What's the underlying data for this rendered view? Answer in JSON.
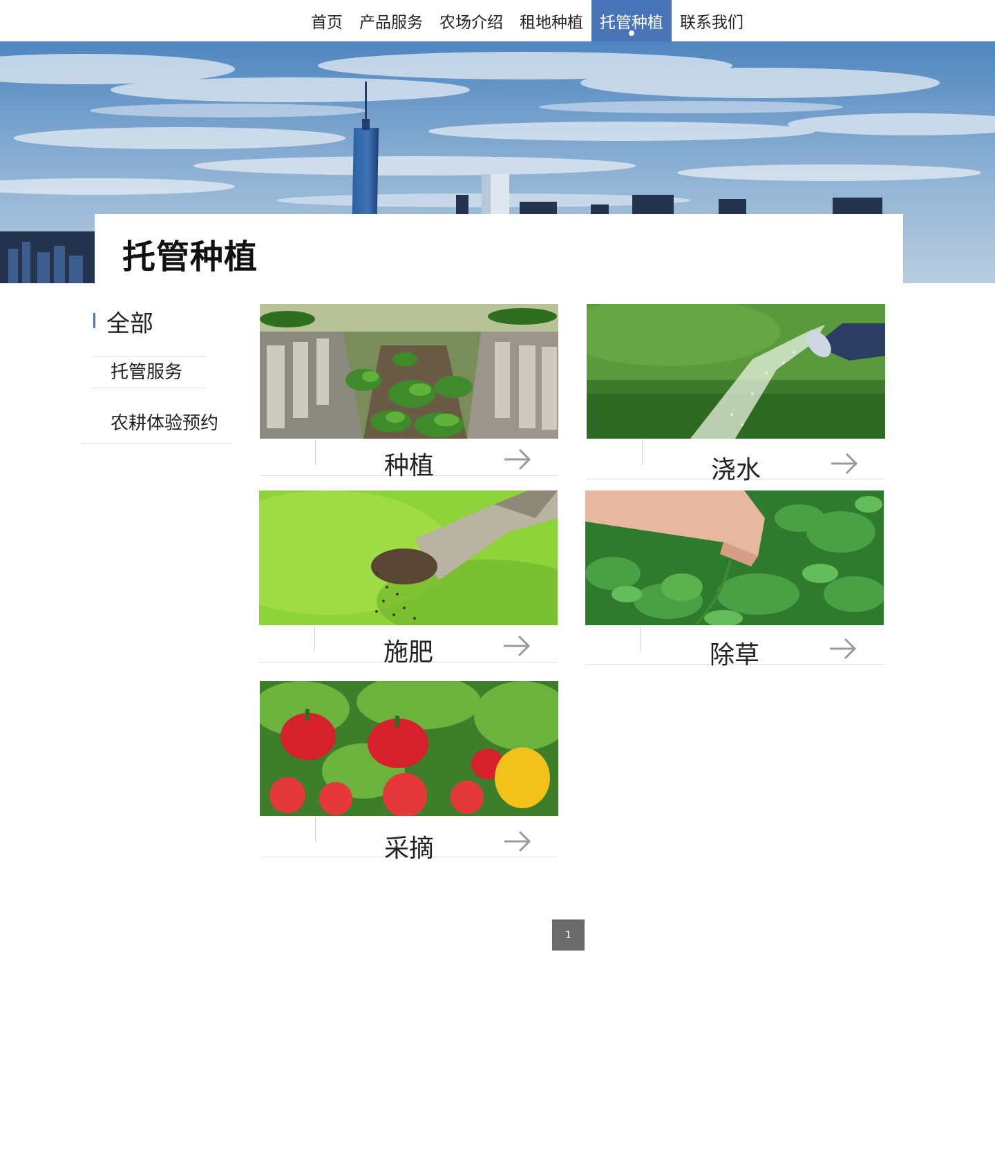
{
  "nav": {
    "items": [
      {
        "label": "首页"
      },
      {
        "label": "产品服务"
      },
      {
        "label": "农场介绍"
      },
      {
        "label": "租地种植"
      },
      {
        "label": "托管种植"
      },
      {
        "label": "联系我们"
      }
    ],
    "active_label": "托管种植"
  },
  "banner": {
    "title": "托管种植"
  },
  "sidebar": {
    "heading": "全部",
    "items": [
      {
        "label": "托管服务"
      },
      {
        "label": "农耕体验预约"
      }
    ]
  },
  "cards": [
    {
      "label": "种植",
      "image": "strawberry-seedlings-image"
    },
    {
      "label": "浇水",
      "image": "watering-can-image"
    },
    {
      "label": "施肥",
      "image": "fertilizer-hand-image"
    },
    {
      "label": "除草",
      "image": "weeding-hand-image"
    },
    {
      "label": "采摘",
      "image": "vegetables-image"
    }
  ],
  "pagination": {
    "current_page": "1"
  },
  "colors": {
    "accent": "#4a74b8",
    "pager_bg": "#6b6b6b",
    "divider": "#dedede"
  }
}
